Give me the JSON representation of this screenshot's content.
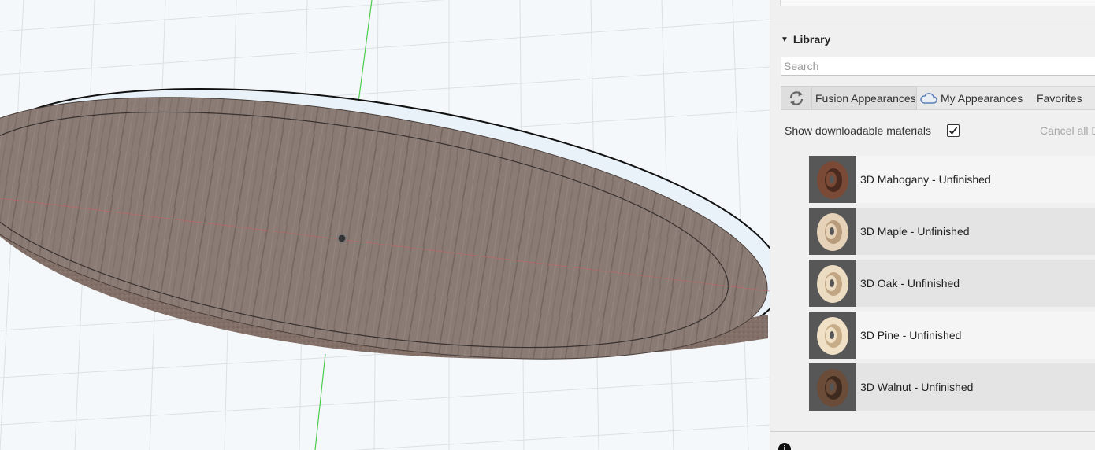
{
  "library": {
    "title": "Library",
    "search_placeholder": "Search",
    "search_value": "",
    "tabs": [
      {
        "label": "Fusion Appearances",
        "icon": "refresh-icon"
      },
      {
        "label": "My Appearances",
        "icon": "cloud-icon"
      },
      {
        "label": "Favorites"
      }
    ],
    "show_downloadable_label": "Show downloadable materials",
    "show_downloadable_checked": true,
    "cancel_label": "Cancel all D",
    "materials": [
      {
        "name": "3D Mahogany - Unfinished",
        "swatch": "#7a4a36",
        "swatch_dark": "#4a2a1e",
        "row_bg": "#f5f5f5"
      },
      {
        "name": "3D Maple - Unfinished",
        "swatch": "#e6d2b8",
        "swatch_dark": "#b89c7c",
        "row_bg": "#e4e4e4"
      },
      {
        "name": "3D Oak - Unfinished",
        "swatch": "#ecdcc2",
        "swatch_dark": "#c2a684",
        "row_bg": "#e4e4e4"
      },
      {
        "name": "3D Pine - Unfinished",
        "swatch": "#efe0c6",
        "swatch_dark": "#c8ae88",
        "row_bg": "#f5f5f5"
      },
      {
        "name": "3D Walnut - Unfinished",
        "swatch": "#6a4c38",
        "swatch_dark": "#3e2a1e",
        "row_bg": "#e4e4e4"
      }
    ]
  },
  "viewport": {
    "model_color": "#8c7d76",
    "grid_color": "#dde2e6",
    "axis_y_color": "#3cc83c",
    "axis_x_color": "#e06060"
  }
}
